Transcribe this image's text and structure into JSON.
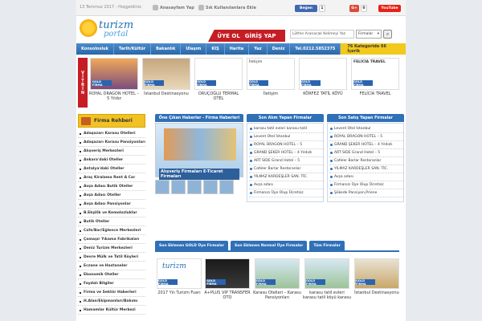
{
  "topbar": {
    "date": "13 Temmuz 2017 - Hoşgeldiniz",
    "homepage": "Anasayfam Yap",
    "favorites": "Sık Kullanılanlara Ekle",
    "fb_like": "Beğen",
    "fb_count": "1",
    "gplus": "G+",
    "gplus_count": "0",
    "youtube": "YouTube"
  },
  "logo": {
    "line1": "turizm",
    "line2": "portal"
  },
  "auth": {
    "register": "ÜYE OL",
    "login": "GİRİŞ YAP"
  },
  "search": {
    "placeholder": "Lütfen Aranacak Kelimeyi Yaz",
    "select": "Firmalar",
    "button_icon": "search-icon"
  },
  "nav": {
    "items": [
      "Konsolosluk",
      "Tarih/Kültür",
      "Bakanlık",
      "Ulaşım",
      "KIŞ",
      "Harita",
      "Yaz",
      "Deniz",
      "Tel.0212.5852375"
    ],
    "categories": "76 Kategoride 66 İçerik"
  },
  "vitrin": {
    "label": "VİTRİN",
    "tag": "GOLD FİRMA",
    "items": [
      {
        "title": "ROYAL DRAGON HOTEL – 5 Yıldız"
      },
      {
        "title": "İstanbul Destinasyonu"
      },
      {
        "title": "ORUÇOĞLU TERMAL OTEL"
      },
      {
        "title": "İletişim"
      },
      {
        "title": "KÖRFEZ TATİL KÖYÜ"
      },
      {
        "title": "FELİCİA TRAVEL"
      }
    ],
    "card4_header": "İletişim",
    "card6_header": "FELİCİA TRAVEL"
  },
  "sidebar": {
    "title": "Firma Rehberi",
    "items": [
      "Adaşazarı Karasu Otelleri",
      "Adaşazarı Karasu Pansiyonları",
      "Alışveriş Merkezleri",
      "Ankara'daki Oteller",
      "Antalya'daki Oteller",
      "Araç Kiralama Rent A Car",
      "Avşa Adası Butik Oteller",
      "Avşa Adası Oteller",
      "Avşa Adası Pansiyonlar",
      "B.Ekşilik ve Kemolozluklar",
      "Butik Oteller",
      "Cafe/Bar/Eğlence Merkezleri",
      "Çamaşır Yıkama Fabrikaları",
      "Deniz Turizm Merkezleri",
      "Devre Mülk ve Tatil Köyleri",
      "Eczane ve Hastaneler",
      "Ekonomik Oteller",
      "Faydalı Bilgiler",
      "Firma ve Sektör Haberleri",
      "H.Alan/Ekipmanları/Bakımı",
      "Hamamlar Kültür Merkezi"
    ]
  },
  "haber": {
    "title": "Öne Çıkan Haberler - Firma Haberleri",
    "caption": "Alışveriş Firmaları E-Ticaret Firmaları"
  },
  "alim": {
    "title": "Son Alım Yapan Firmalar",
    "items": [
      "karasu tatil evleri karasu tatil",
      "Levent Otel İstanbul",
      "ROYAL DRAGON HOTEL – 5",
      "GRAND ŞEKER HOTEL – 4 Yıldızlı",
      "ART SIDE Grand Hotel – 5",
      "Cafeler Barlar Restoranlar",
      "YILMAZ KARDEŞLER SAN. TİC.",
      "Avşa adası",
      "Firmanızı Üye Olup Ücretsiz"
    ]
  },
  "satis": {
    "title": "Son Satış Yapan Firmalar",
    "items": [
      "Levent Otel İstanbul",
      "ROYAL DRAGON HOTEL – 5",
      "GRAND ŞEKER HOTEL – 4 Yıldızlı",
      "ART SIDE Grand Hotel – 5",
      "Cafeler Barlar Restoranlar",
      "YILMAZ KARDEŞLER SAN. TİC.",
      "Avşa adası",
      "Firmanızı Üye Olup Ücretsiz",
      "Şökede Pansiyon,Priene"
    ]
  },
  "firmtabs": [
    "Son Eklenen GOLD Üye Firmalar",
    "Son Eklenen Normal Üye Firmalar",
    "Tüm Firmalar"
  ],
  "firms": [
    {
      "title": "2017 Yılı Turizm Fuarı"
    },
    {
      "title": "A+PLUS VIP TRANSFER OTO"
    },
    {
      "title": "Karasu Otelleri – Karasu Pansiyonları"
    },
    {
      "title": "karasu tatil evleri karasu tatil köyü karasu"
    },
    {
      "title": "İstanbul Destinasyonu"
    }
  ],
  "colors": {
    "accent": "#2f70b8",
    "brand_red": "#c61d24",
    "gold": "#f0c224"
  }
}
